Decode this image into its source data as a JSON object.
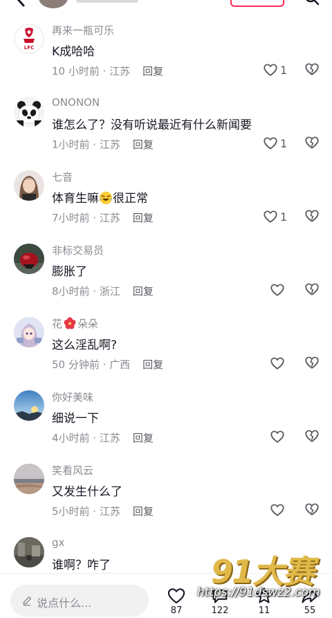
{
  "comments": [
    {
      "name": "再来一瓶可乐",
      "text": "K成哈哈",
      "time": "10 小时前 · 江苏",
      "reply": "回复",
      "likes": "1",
      "avatar": "lfc-crest"
    },
    {
      "name": "ONONON",
      "text": "谁怎么了？没有听说最近有什么新闻要",
      "time": "1小时前 · 江苏",
      "reply": "回复",
      "likes": "1",
      "avatar": "panda"
    },
    {
      "name": "七音",
      "text_before": "体育生嘛",
      "text_after": "很正常",
      "emoji": "laughing-crying-emoji",
      "time": "7小时前 · 江苏",
      "reply": "回复",
      "likes": "1",
      "avatar": "woman-portrait"
    },
    {
      "name": "非标交易员",
      "text": "膨胀了",
      "time": "8小时前 · 浙江",
      "reply": "回复",
      "likes": "",
      "avatar": "red-object"
    },
    {
      "name_before": "花",
      "name_after": "朵朵",
      "name_emoji": "hibiscus-emoji",
      "text": "这么淫乱啊?",
      "time": "50 分钟前 · 广西",
      "reply": "回复",
      "likes": "",
      "avatar": "anime-girl"
    },
    {
      "name": "你好美味",
      "text": "细说一下",
      "time": "4小时前 · 江苏",
      "reply": "回复",
      "likes": "",
      "avatar": "sky-sunset"
    },
    {
      "name": "笑看风云",
      "text": "又发生什么了",
      "time": "5小时前 · 江苏",
      "reply": "回复",
      "likes": "",
      "avatar": "beach-landscape"
    },
    {
      "name": "gx",
      "text": "谁啊？咋了",
      "avatar": "street-photo"
    }
  ],
  "bottom": {
    "placeholder": "说点什么...",
    "counts": {
      "like": "87",
      "comment": "122",
      "favorite": "11",
      "share": "55"
    }
  },
  "watermark": {
    "logo": "91大赛",
    "url": "https://91dswz2.com"
  },
  "colors": {
    "accent": "#fe2c55",
    "muted": "#8a8b91",
    "text": "#161823",
    "watermark": "#e0b94a"
  }
}
